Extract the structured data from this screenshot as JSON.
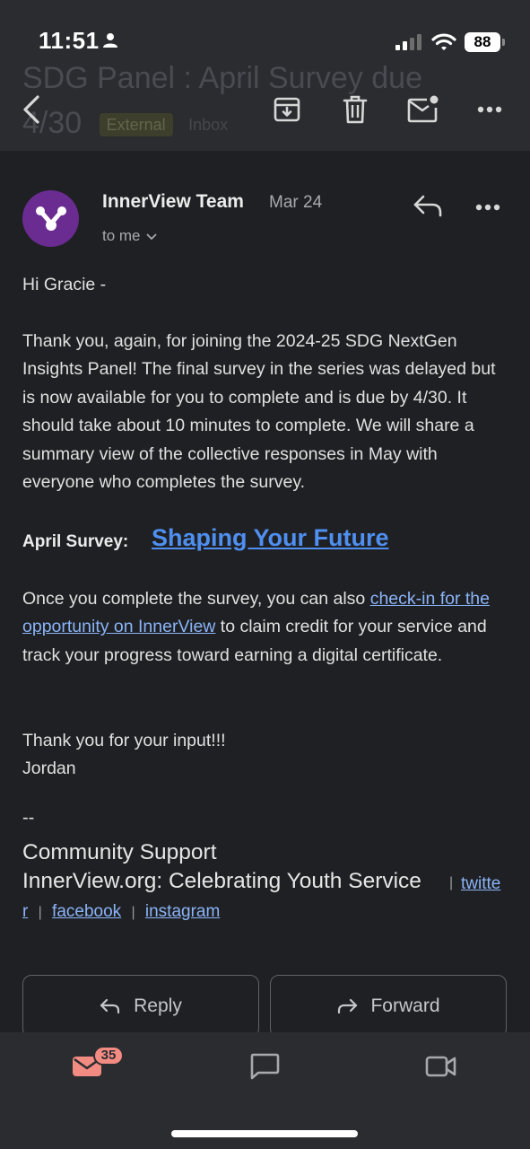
{
  "status_bar": {
    "time": "11:51",
    "battery": "88"
  },
  "header": {
    "subject_ghost": "SDG Panel : April Survey due 4/30",
    "label_chip": "External",
    "folder": "Inbox"
  },
  "message": {
    "sender": "InnerView Team",
    "date": "Mar 24",
    "recipient": "to me",
    "avatar_color": "#6a2c91"
  },
  "body": {
    "greeting": "Hi Gracie -",
    "para1": "Thank you, again, for joining the 2024-25 SDG NextGen Insights Panel! The final survey in the series was delayed but is now available for you to complete and is due by 4/30. It should take about 10 minutes to complete. We will share a summary view of the collective responses in May with everyone who completes the survey.",
    "survey_label": "April Survey:",
    "survey_link": "Shaping Your Future",
    "para2_before": "Once you complete the survey, you can also ",
    "para2_link": "check-in for the opportunity on InnerView",
    "para2_after": " to claim credit for your service and track your progress toward earning a digital certificate.",
    "thanks": "Thank you for your input!!!",
    "signoff": "Jordan"
  },
  "signature": {
    "dash": "--",
    "line1": "Community Support",
    "line2": "InnerView.org: Celebrating Youth Service",
    "twitter": "twitter",
    "facebook": "facebook",
    "instagram": "instagram",
    "separator": "|"
  },
  "actions": {
    "reply": "Reply",
    "forward": "Forward"
  },
  "bottom_nav": {
    "mail_badge": "35"
  },
  "colors": {
    "background": "#1f2023",
    "bar": "#2b2c30",
    "link": "#8ab4f8",
    "badge": "#f28b82"
  }
}
